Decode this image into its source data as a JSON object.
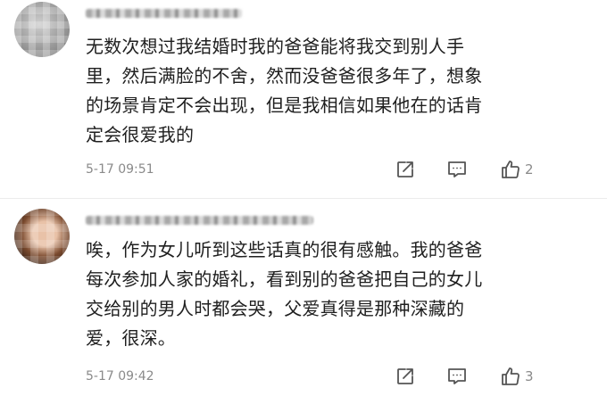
{
  "comments": [
    {
      "lines": [
        "无数次想过我结婚时我的爸爸能将我交到别人手",
        "里，然后满脸的不舍，然而没爸爸很多年了，想象",
        "的场景肯定不会出现，但是我相信如果他在的话肯",
        "定会很爱我的"
      ],
      "timestamp": "5-17 09:51",
      "likes": "2"
    },
    {
      "lines": [
        "唉，作为女儿听到这些话真的很有感触。我的爸爸",
        "每次参加人家的婚礼，看到别的爸爸把自己的女儿",
        "交给别的男人时都会哭，父爱真得是那种深藏的",
        "爱，很深。"
      ],
      "timestamp": "5-17 09:42",
      "likes": "3"
    }
  ],
  "icons": [
    "share-icon",
    "reply-icon",
    "like-icon"
  ],
  "colors": {
    "text": "#1f1f1f",
    "meta": "#8a8a8a",
    "icon": "#555555"
  }
}
